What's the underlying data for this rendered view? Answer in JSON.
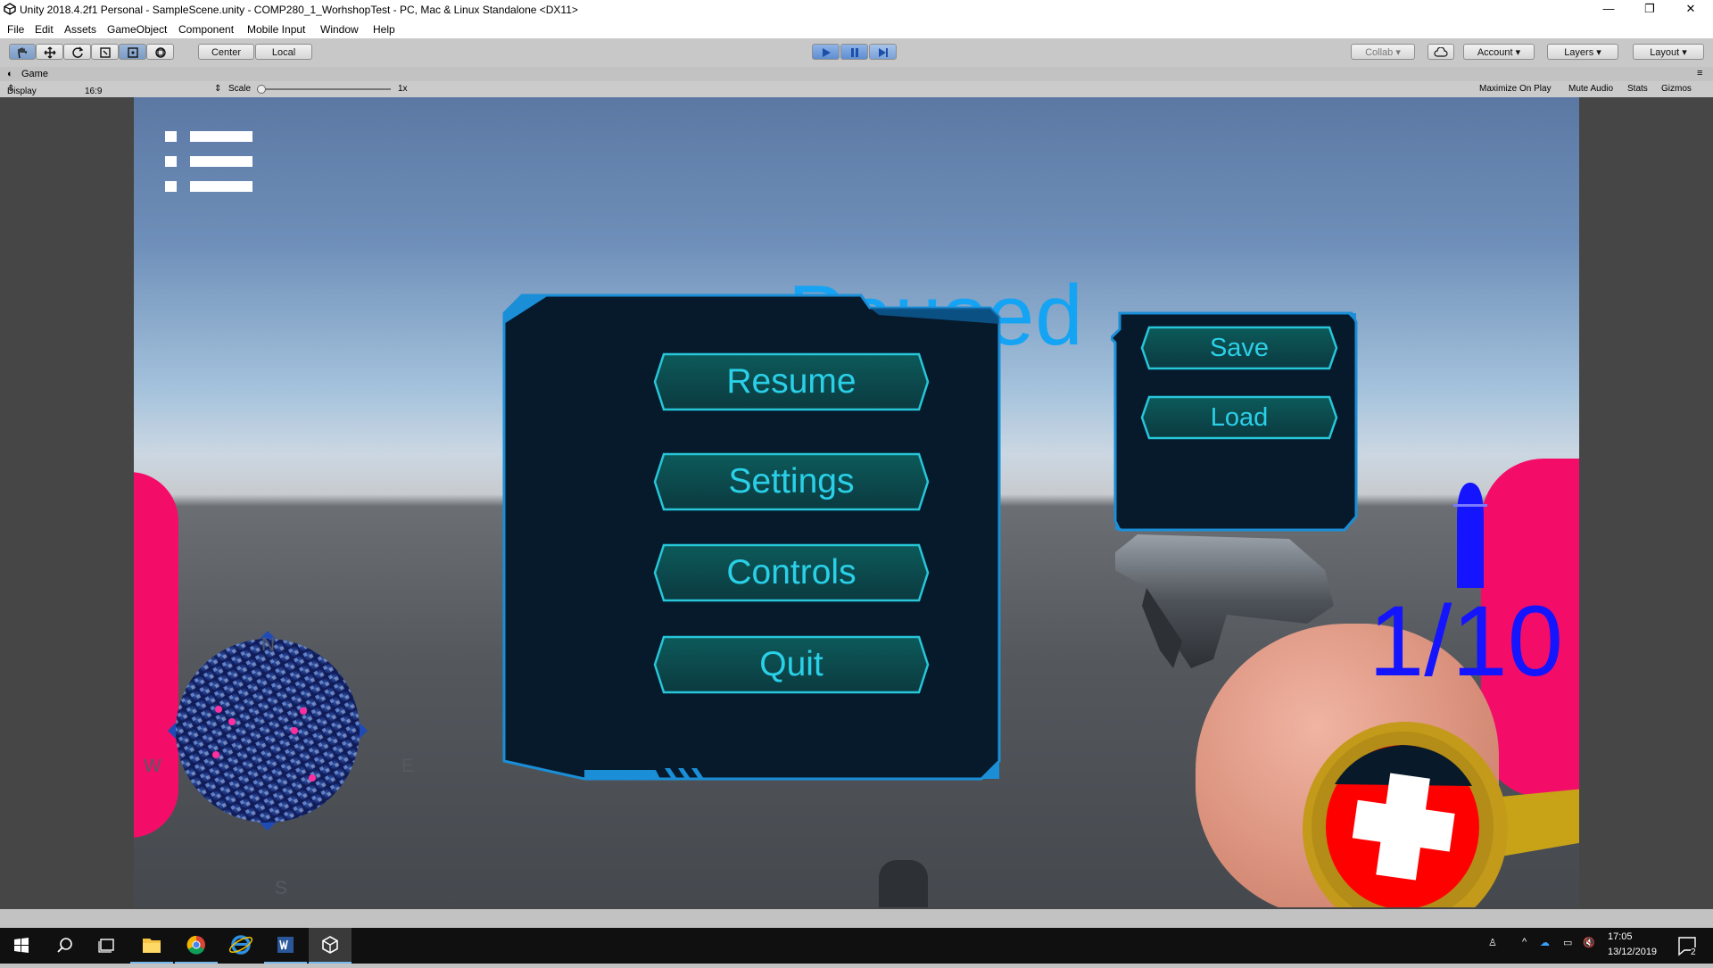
{
  "window": {
    "title": "Unity 2018.4.2f1 Personal - SampleScene.unity - COMP280_1_WorhshopTest - PC, Mac & Linux Standalone <DX11>",
    "minimize": "—",
    "restore": "❐",
    "close": "✕"
  },
  "menu": [
    "File",
    "Edit",
    "Assets",
    "GameObject",
    "Component",
    "Mobile Input",
    "Window",
    "Help"
  ],
  "toolbar": {
    "pivot": "Center",
    "space": "Local",
    "collab": "Collab",
    "account": "Account",
    "layers": "Layers",
    "layout": "Layout"
  },
  "game_tab": {
    "label": "Game",
    "display": "Display 1",
    "aspect": "16:9",
    "scale_label": "Scale",
    "scale_value": "1x",
    "maximize": "Maximize On Play",
    "mute": "Mute Audio",
    "stats": "Stats",
    "gizmos": "Gizmos"
  },
  "hud": {
    "paused_title": "Paused",
    "menu_buttons": [
      "Resume",
      "Settings",
      "Controls",
      "Quit"
    ],
    "save_label": "Save",
    "load_label": "Load",
    "ammo": "1/10",
    "compass": {
      "n": "N",
      "s": "S",
      "e": "E",
      "w": "W"
    }
  },
  "taskbar": {
    "time": "17:05",
    "date": "13/12/2019",
    "notifications": "2"
  },
  "colors": {
    "paused_text": "#15a4f4",
    "button_text": "#2ad0e8",
    "panel": "#061a2c",
    "panel_border": "#1a8fd8",
    "ammo": "#1414ff"
  }
}
